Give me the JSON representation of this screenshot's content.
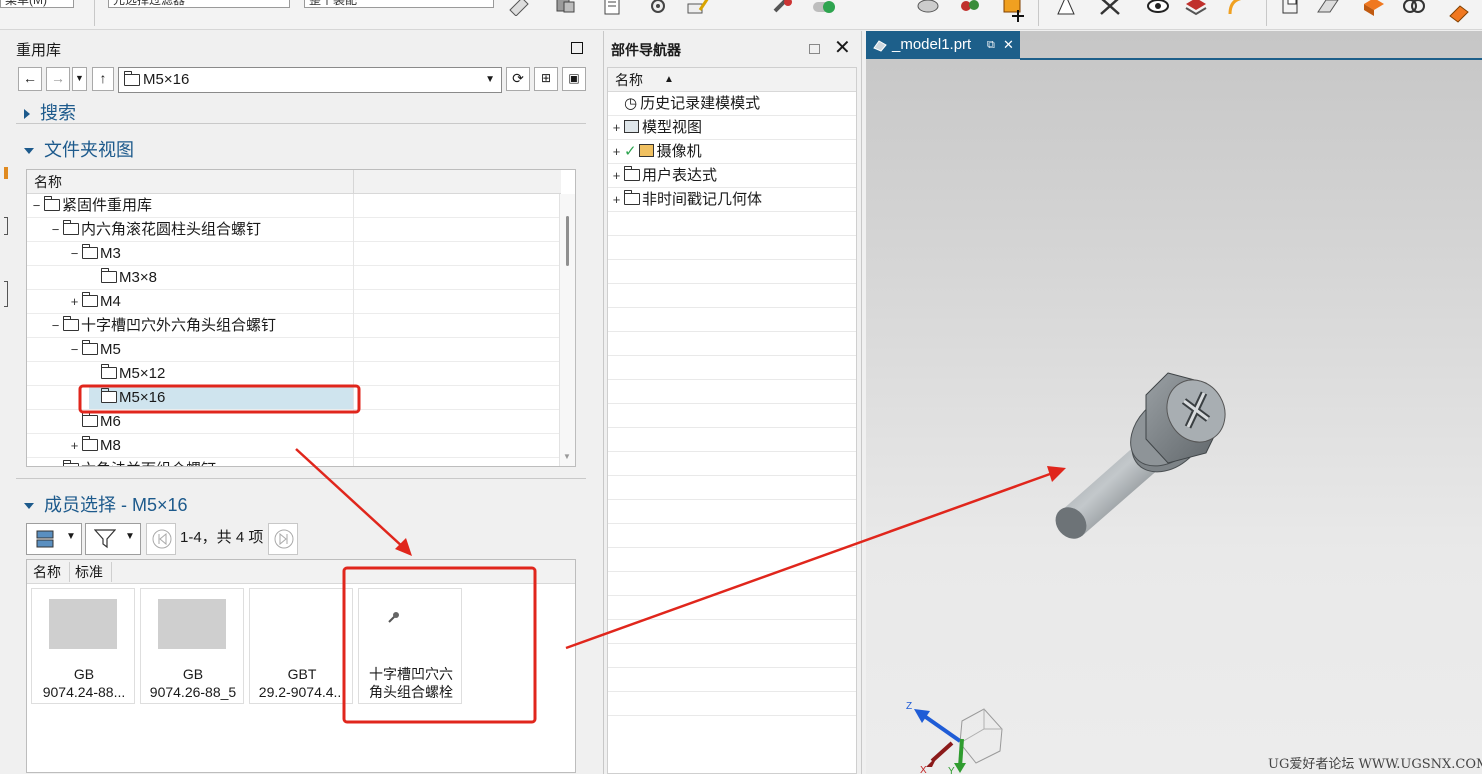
{
  "toolbar": {
    "combo_1": "元选择过滤器",
    "combo_2": "整个装配"
  },
  "reuse_library": {
    "title": "重用库",
    "path_value": "M5×16",
    "search_label": "搜索",
    "folder_view_label": "文件夹视图",
    "tree_column_header": "名称",
    "tree": [
      {
        "label": "紧固件重用库",
        "expander": "−",
        "icon": "part-library-icon"
      },
      {
        "label": "内六角滚花圆柱头组合螺钉",
        "expander": "−",
        "icon": "folder-icon"
      },
      {
        "label": "M3",
        "expander": "−",
        "icon": "folder-icon"
      },
      {
        "label": "M3×8",
        "expander": "",
        "icon": "folder-icon"
      },
      {
        "label": "M4",
        "expander": "+",
        "icon": "folder-icon"
      },
      {
        "label": "十字槽凹穴外六角头组合螺钉",
        "expander": "−",
        "icon": "folder-icon"
      },
      {
        "label": "M5",
        "expander": "−",
        "icon": "folder-icon"
      },
      {
        "label": "M5×12",
        "expander": "",
        "icon": "folder-icon"
      },
      {
        "label": "M5×16",
        "expander": "",
        "icon": "folder-icon",
        "selected": true
      },
      {
        "label": "M6",
        "expander": "",
        "icon": "folder-icon"
      },
      {
        "label": "M8",
        "expander": "+",
        "icon": "folder-icon"
      },
      {
        "label": "六角法兰面组合螺钉",
        "expander": "",
        "icon": "folder-icon"
      }
    ],
    "member_select_label": "成员选择 - M5×16",
    "paging_text": "1-4，共 4 项",
    "member_columns": [
      "名称",
      "标准"
    ],
    "members": [
      {
        "line1": "GB",
        "line2": "9074.24-88..."
      },
      {
        "line1": "GB",
        "line2": "9074.26-88_5"
      },
      {
        "line1": "GBT",
        "line2": "29.2-9074.4..."
      },
      {
        "line1": "十字槽凹穴六",
        "line2": "角头组合螺栓"
      }
    ]
  },
  "part_navigator": {
    "title": "部件导航器",
    "column_header": "名称",
    "rows": [
      {
        "label": "历史记录建模模式",
        "expander": "",
        "icon": "clock-icon"
      },
      {
        "label": "模型视图",
        "expander": "+",
        "icon": "model-view-icon"
      },
      {
        "label": "摄像机",
        "expander": "+",
        "icon": "camera-icon",
        "checked": true
      },
      {
        "label": "用户表达式",
        "expander": "+",
        "icon": "folder-icon"
      },
      {
        "label": "非时间戳记几何体",
        "expander": "+",
        "icon": "folder-icon"
      }
    ]
  },
  "viewport": {
    "tab_label": "_model1.prt",
    "triad_z": "Z",
    "triad_x": "X",
    "triad_y": "Y",
    "watermark": "UG爱好者论坛 WWW.UGSNX.COM"
  },
  "colors": {
    "accent_blue": "#1d5a8c",
    "tab_blue": "#1d5f8a",
    "annotation_red": "#e0261c",
    "selection": "#cfe4ee"
  }
}
